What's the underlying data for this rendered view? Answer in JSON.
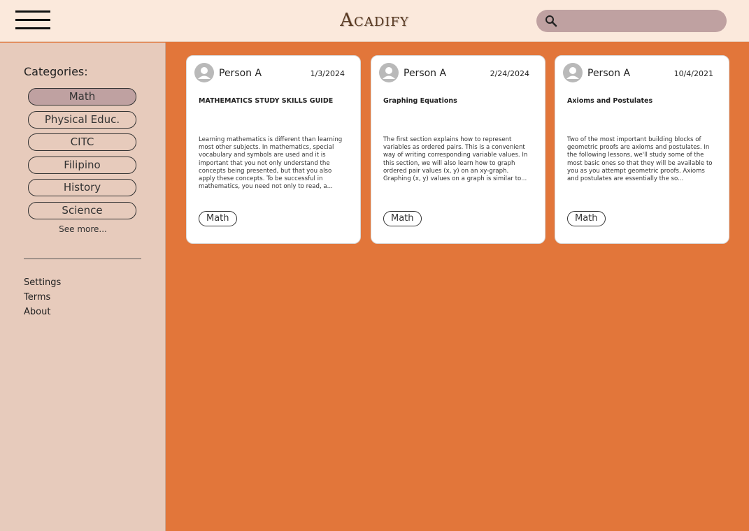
{
  "header": {
    "brand": "Acadify",
    "search": {
      "placeholder": "",
      "value": ""
    },
    "search_icon": "search-icon",
    "menu_icon": "hamburger-icon"
  },
  "sidebar": {
    "title": "Categories:",
    "categories": [
      {
        "label": "Math",
        "active": true
      },
      {
        "label": "Physical Educ.",
        "active": false
      },
      {
        "label": "CITC",
        "active": false
      },
      {
        "label": "Filipino",
        "active": false
      },
      {
        "label": "History",
        "active": false
      },
      {
        "label": "Science",
        "active": false
      }
    ],
    "see_more": "See more...",
    "links": [
      "Settings",
      "Terms",
      "About"
    ]
  },
  "posts": [
    {
      "author": "Person A",
      "date": "1/3/2024",
      "title": "MATHEMATICS STUDY SKILLS GUIDE",
      "excerpt": "Learning mathematics is different than learning most other subjects. In mathematics, special vocabulary and symbols are used and it is important that you not only understand the concepts being presented, but that you also apply these concepts. To be successful in mathematics, you need not only to read, a...",
      "tag": "Math"
    },
    {
      "author": "Person A",
      "date": "2/24/2024",
      "title": "Graphing Equations",
      "excerpt": "The first section explains how to represent variables as ordered pairs. This is a convenient way of writing corresponding variable values. In this section, we will also learn how to graph ordered pair values (x, y) on an xy-graph. Graphing (x, y) values on a graph is similar to...",
      "tag": "Math"
    },
    {
      "author": "Person A",
      "date": "10/4/2021",
      "title": "Axioms and Postulates",
      "excerpt": "Two of the most important building blocks of geometric proofs are axioms and postulates. In the following lessons, we'll study some of the most basic ones so that they will be available to you as you attempt geometric proofs. Axioms and postulates are essentially the so...",
      "tag": "Math"
    }
  ],
  "colors": {
    "topbar": "#fbe9dc",
    "sidebar": "#e7cbbc",
    "content": "#e2763a",
    "active_pill": "#bfa1a1",
    "search_bg": "#bfa1a1",
    "card": "#ffffff"
  }
}
